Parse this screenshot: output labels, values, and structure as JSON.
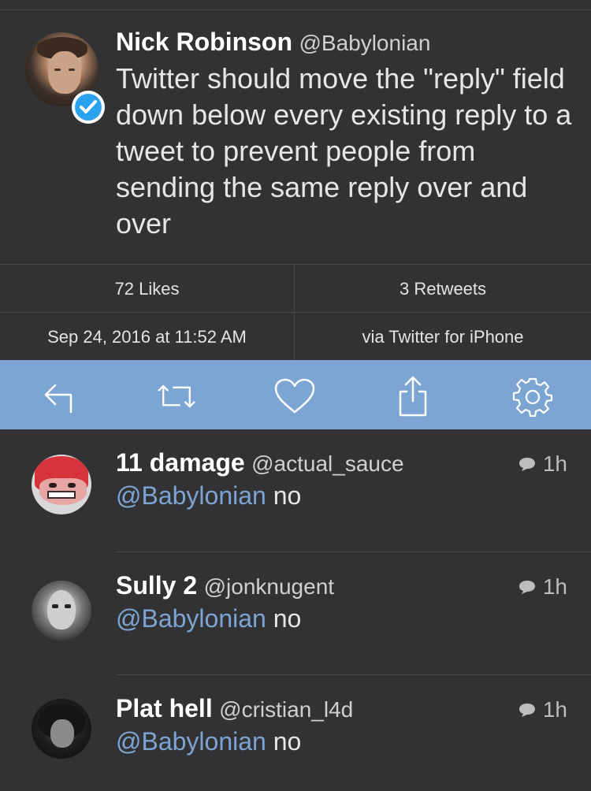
{
  "main_tweet": {
    "name": "Nick Robinson",
    "handle": "@Babylonian",
    "verified": true,
    "text": "Twitter should move the \"reply\" field down below every existing reply to a tweet to prevent people from sending the same reply over and over"
  },
  "stats": {
    "likes": "72 Likes",
    "retweets": "3 Retweets",
    "timestamp": "Sep 24, 2016 at 11:52 AM",
    "source": "via Twitter for iPhone"
  },
  "actions": {
    "icons": [
      "reply-icon",
      "retweet-icon",
      "like-icon",
      "share-icon",
      "settings-icon"
    ]
  },
  "colors": {
    "background": "#323234",
    "action_bar": "#7ca5d3",
    "mention": "#7ca5d3",
    "verified": "#2aa3ef"
  },
  "replies": [
    {
      "name": "11 damage",
      "handle": "@actual_sauce",
      "mention": "@Babylonian",
      "text": "no",
      "time": "1h"
    },
    {
      "name": "Sully 2",
      "handle": "@jonknugent",
      "mention": "@Babylonian",
      "text": "no",
      "time": "1h"
    },
    {
      "name": "Plat hell",
      "handle": "@cristian_l4d",
      "mention": "@Babylonian",
      "text": "no",
      "time": "1h"
    }
  ]
}
